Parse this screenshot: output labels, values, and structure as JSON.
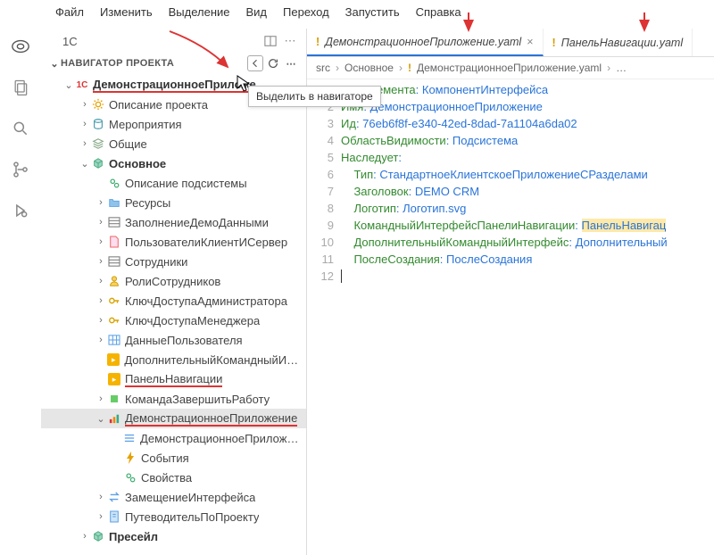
{
  "menu": {
    "items": [
      "Файл",
      "Изменить",
      "Выделение",
      "Вид",
      "Переход",
      "Запустить",
      "Справка"
    ]
  },
  "side": {
    "title": "1C",
    "nav_title": "НАВИГАТОР ПРОЕКТА",
    "tooltip": "Выделить в навигаторе"
  },
  "tree": [
    {
      "d": 0,
      "a": "v",
      "i": "1c",
      "t": "ДемонстрационноеПриложе…",
      "bold": true,
      "u": true
    },
    {
      "d": 1,
      "a": ">",
      "i": "gear",
      "t": "Описание проекта"
    },
    {
      "d": 1,
      "a": ">",
      "i": "db",
      "t": "Мероприятия"
    },
    {
      "d": 1,
      "a": ">",
      "i": "layers",
      "t": "Общие"
    },
    {
      "d": 1,
      "a": "v",
      "i": "cube",
      "t": "Основное",
      "bold": true
    },
    {
      "d": 2,
      "a": "",
      "i": "mgear",
      "t": "Описание подсистемы"
    },
    {
      "d": 2,
      "a": ">",
      "i": "folder",
      "t": "Ресурсы"
    },
    {
      "d": 2,
      "a": ">",
      "i": "catalog",
      "t": "ЗаполнениеДемоДанными"
    },
    {
      "d": 2,
      "a": ">",
      "i": "doc",
      "t": "ПользователиКлиентИСервер"
    },
    {
      "d": 2,
      "a": ">",
      "i": "catalog",
      "t": "Сотрудники"
    },
    {
      "d": 2,
      "a": ">",
      "i": "user",
      "t": "РолиСотрудников"
    },
    {
      "d": 2,
      "a": ">",
      "i": "key",
      "t": "КлючДоступаАдминистратора"
    },
    {
      "d": 2,
      "a": ">",
      "i": "key",
      "t": "КлючДоступаМенеджера"
    },
    {
      "d": 2,
      "a": ">",
      "i": "grid",
      "t": "ДанныеПользователя"
    },
    {
      "d": 2,
      "a": "",
      "i": "play",
      "t": "ДополнительныйКомандныйИнт…"
    },
    {
      "d": 2,
      "a": "",
      "i": "play",
      "t": "ПанельНавигации",
      "u": true
    },
    {
      "d": 2,
      "a": ">",
      "i": "stop",
      "t": "КомандаЗавершитьРаботу"
    },
    {
      "d": 2,
      "a": "v",
      "i": "bars",
      "t": "ДемонстрационноеПриложение",
      "sel": true,
      "u": true
    },
    {
      "d": 3,
      "a": "",
      "i": "list",
      "t": "ДемонстрационноеПриложение"
    },
    {
      "d": 3,
      "a": "",
      "i": "bolt",
      "t": "События"
    },
    {
      "d": 3,
      "a": "",
      "i": "mgear",
      "t": "Свойства"
    },
    {
      "d": 2,
      "a": ">",
      "i": "swap",
      "t": "ЗамещениеИнтерфейса"
    },
    {
      "d": 2,
      "a": ">",
      "i": "guide",
      "t": "ПутеводительПоПроекту"
    },
    {
      "d": 1,
      "a": ">",
      "i": "cube",
      "t": "Пресейл",
      "bold": true
    }
  ],
  "tabs": [
    {
      "label": "ДемонстрационноеПриложение.yaml",
      "active": true,
      "close": true
    },
    {
      "label": "ПанельНавигации.yaml",
      "active": false,
      "close": false
    }
  ],
  "breadcrumb": {
    "parts": [
      "src",
      "Основное",
      "ДемонстрационноеПриложение.yaml",
      "…"
    ],
    "exclIndex": 2
  },
  "code": {
    "lines": [
      {
        "n": "",
        "k": "ВидЭлемента",
        "p": ": ",
        "v": "КомпонентИнтерфейса"
      },
      {
        "n": 2,
        "k": "Имя",
        "p": ": ",
        "v": "ДемонстрационноеПриложение"
      },
      {
        "n": 3,
        "k": "Ид",
        "p": ": ",
        "v": "76eb6f8f-e340-42ed-8dad-7a1104a6da02"
      },
      {
        "n": 4,
        "k": "ОбластьВидимости",
        "p": ": ",
        "v": "Подсистема"
      },
      {
        "n": 5,
        "k": "Наследует",
        "p": ":",
        "v": ""
      },
      {
        "n": 6,
        "k": "Тип",
        "p": ": ",
        "v": "СтандартноеКлиентскоеПриложениеСРазделами",
        "ind": 1
      },
      {
        "n": 7,
        "k": "Заголовок",
        "p": ": ",
        "v": "DEMO CRM",
        "ind": 1
      },
      {
        "n": 8,
        "k": "Логотип",
        "p": ": ",
        "v": "Логотип.svg",
        "ind": 1
      },
      {
        "n": 9,
        "k": "КомандныйИнтерфейсПанелиНавигации",
        "p": ": ",
        "v": "ПанельНавигац",
        "ind": 1,
        "hl": true
      },
      {
        "n": 10,
        "k": "ДополнительныйКомандныйИнтерфейс",
        "p": ": ",
        "v": "Дополнительный",
        "ind": 1
      },
      {
        "n": 11,
        "k": "ПослеСоздания",
        "p": ": ",
        "v": "ПослеСоздания",
        "ind": 1
      },
      {
        "n": 12,
        "k": "",
        "p": "",
        "v": ""
      }
    ]
  }
}
